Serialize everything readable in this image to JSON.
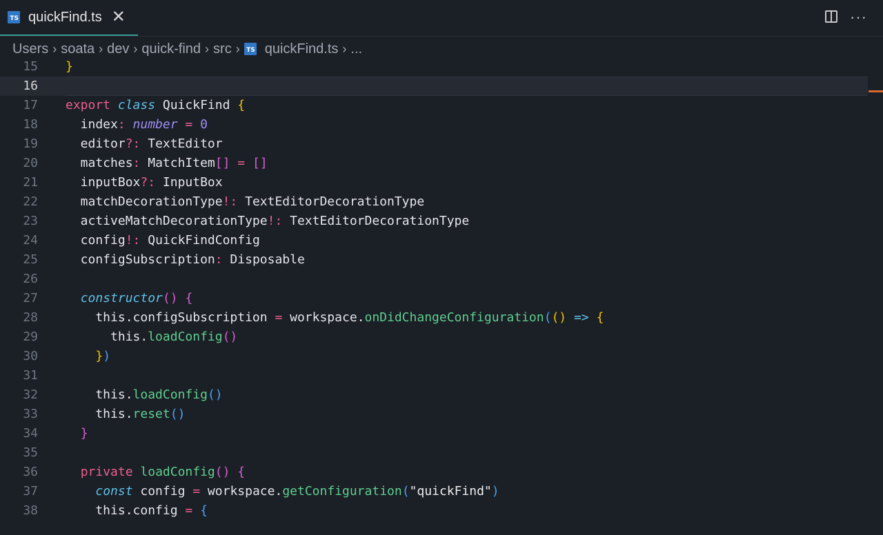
{
  "tab": {
    "title": "quickFind.ts",
    "icon_label": "TS"
  },
  "breadcrumb": [
    "Users",
    "soata",
    "dev",
    "quick-find",
    "src",
    "quickFind.ts",
    "..."
  ],
  "colors": {
    "accent_tab_border": "#3a9a8f",
    "ts_icon": "#3178c6",
    "scroll_marker": "#d86b2c"
  },
  "editor": {
    "current_line": 16,
    "lines": [
      {
        "n": "15",
        "t": [
          [
            "}",
            "b1"
          ]
        ]
      },
      {
        "n": "16",
        "t": []
      },
      {
        "n": "17",
        "t": [
          [
            "export ",
            "keyword"
          ],
          [
            "class",
            "storage"
          ],
          [
            " QuickFind ",
            "class"
          ],
          [
            "{",
            "b1"
          ]
        ]
      },
      {
        "n": "18",
        "t": [
          [
            "  index",
            "default"
          ],
          [
            ":",
            "punct"
          ],
          [
            " ",
            "default"
          ],
          [
            "number",
            "type-it"
          ],
          [
            " ",
            "default"
          ],
          [
            "=",
            "op"
          ],
          [
            " ",
            "default"
          ],
          [
            "0",
            "number"
          ]
        ]
      },
      {
        "n": "19",
        "t": [
          [
            "  editor",
            "default"
          ],
          [
            "?:",
            "punct"
          ],
          [
            " TextEditor",
            "type"
          ]
        ]
      },
      {
        "n": "20",
        "t": [
          [
            "  matches",
            "default"
          ],
          [
            ":",
            "punct"
          ],
          [
            " MatchItem",
            "type"
          ],
          [
            "[]",
            "b2"
          ],
          [
            " ",
            "default"
          ],
          [
            "=",
            "op"
          ],
          [
            " ",
            "default"
          ],
          [
            "[]",
            "b2"
          ]
        ]
      },
      {
        "n": "21",
        "t": [
          [
            "  inputBox",
            "default"
          ],
          [
            "?:",
            "punct"
          ],
          [
            " InputBox",
            "type"
          ]
        ]
      },
      {
        "n": "22",
        "t": [
          [
            "  matchDecorationType",
            "default"
          ],
          [
            "!:",
            "punct"
          ],
          [
            " TextEditorDecorationType",
            "type"
          ]
        ]
      },
      {
        "n": "23",
        "t": [
          [
            "  activeMatchDecorationType",
            "default"
          ],
          [
            "!:",
            "punct"
          ],
          [
            " TextEditorDecorationType",
            "type"
          ]
        ]
      },
      {
        "n": "24",
        "t": [
          [
            "  config",
            "default"
          ],
          [
            "!:",
            "punct"
          ],
          [
            " QuickFindConfig",
            "type"
          ]
        ]
      },
      {
        "n": "25",
        "t": [
          [
            "  configSubscription",
            "default"
          ],
          [
            ":",
            "punct"
          ],
          [
            " Disposable",
            "type"
          ]
        ]
      },
      {
        "n": "26",
        "t": []
      },
      {
        "n": "27",
        "t": [
          [
            "  ",
            "default"
          ],
          [
            "constructor",
            "func-it"
          ],
          [
            "()",
            "b2"
          ],
          [
            " ",
            "default"
          ],
          [
            "{",
            "b2"
          ]
        ]
      },
      {
        "n": "28",
        "t": [
          [
            "    this.configSubscription ",
            "default"
          ],
          [
            "=",
            "op"
          ],
          [
            " workspace.",
            "default"
          ],
          [
            "onDidChangeConfiguration",
            "func"
          ],
          [
            "(",
            "b3"
          ],
          [
            "()",
            "b1"
          ],
          [
            " ",
            "default"
          ],
          [
            "=>",
            "arrow"
          ],
          [
            " ",
            "default"
          ],
          [
            "{",
            "b1"
          ]
        ]
      },
      {
        "n": "29",
        "t": [
          [
            "      this.",
            "default"
          ],
          [
            "loadConfig",
            "func"
          ],
          [
            "()",
            "b2"
          ]
        ]
      },
      {
        "n": "30",
        "t": [
          [
            "    ",
            "default"
          ],
          [
            "}",
            "b1"
          ],
          [
            ")",
            "b3"
          ]
        ]
      },
      {
        "n": "31",
        "t": []
      },
      {
        "n": "32",
        "t": [
          [
            "    this.",
            "default"
          ],
          [
            "loadConfig",
            "func"
          ],
          [
            "()",
            "b3"
          ]
        ]
      },
      {
        "n": "33",
        "t": [
          [
            "    this.",
            "default"
          ],
          [
            "reset",
            "func"
          ],
          [
            "()",
            "b3"
          ]
        ]
      },
      {
        "n": "34",
        "t": [
          [
            "  ",
            "default"
          ],
          [
            "}",
            "b2"
          ]
        ]
      },
      {
        "n": "35",
        "t": []
      },
      {
        "n": "36",
        "t": [
          [
            "  ",
            "default"
          ],
          [
            "private ",
            "keyword"
          ],
          [
            "loadConfig",
            "func"
          ],
          [
            "()",
            "b2"
          ],
          [
            " ",
            "default"
          ],
          [
            "{",
            "b2"
          ]
        ]
      },
      {
        "n": "37",
        "t": [
          [
            "    ",
            "default"
          ],
          [
            "const",
            "storage"
          ],
          [
            " config ",
            "default"
          ],
          [
            "=",
            "op"
          ],
          [
            " workspace.",
            "default"
          ],
          [
            "getConfiguration",
            "func"
          ],
          [
            "(",
            "b3"
          ],
          [
            "\"quickFind\"",
            "string"
          ],
          [
            ")",
            "b3"
          ]
        ]
      },
      {
        "n": "38",
        "t": [
          [
            "    this.config ",
            "default"
          ],
          [
            "=",
            "op"
          ],
          [
            " ",
            "default"
          ],
          [
            "{",
            "b3"
          ]
        ]
      }
    ]
  }
}
